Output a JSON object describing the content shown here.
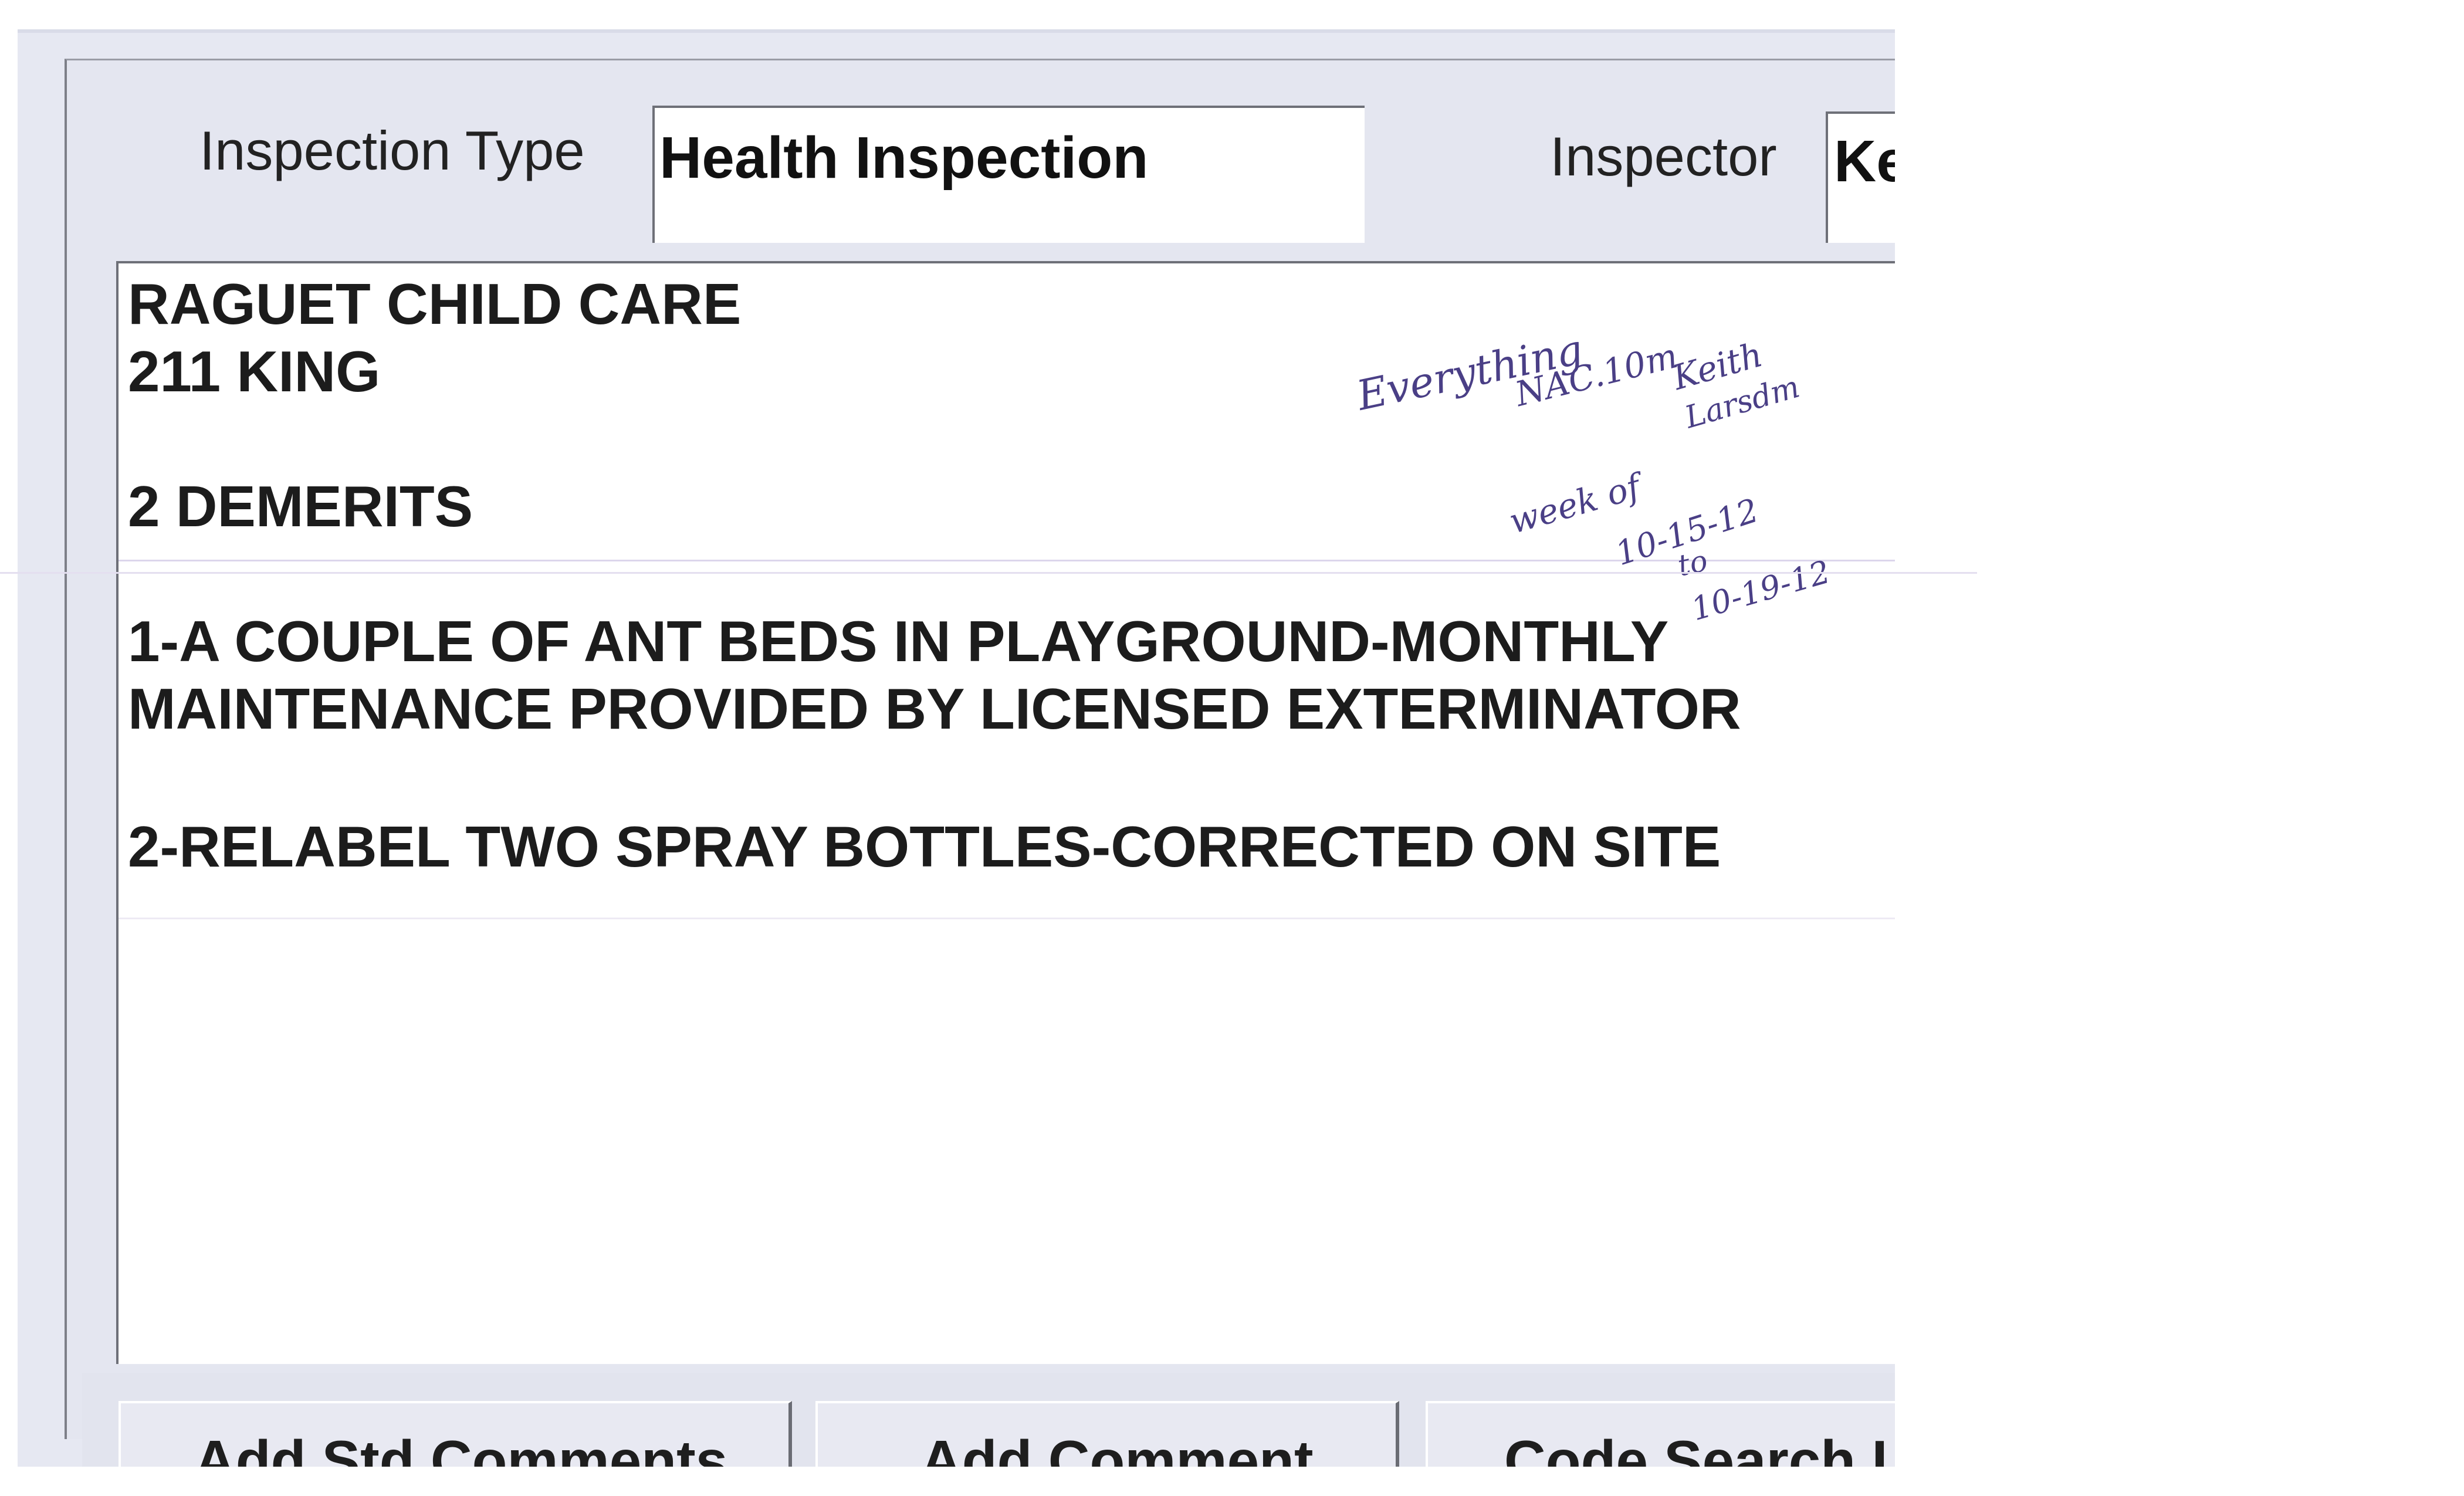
{
  "form": {
    "inspection_type_label": "Inspection Type",
    "inspection_type_value": "Health Inspection",
    "inspector_label": "Inspector",
    "inspector_value": "Ke"
  },
  "comments": {
    "lines": [
      "RAGUET CHILD CARE",
      "211 KING",
      "2 DEMERITS",
      "1-A COUPLE OF ANT BEDS IN PLAYGROUND-MONTHLY",
      "MAINTENANCE PROVIDED BY LICENSED EXTERMINATOR",
      "2-RELABEL TWO SPRAY BOTTLES-CORRECTED ON SITE"
    ]
  },
  "buttons": {
    "add_std_comments": {
      "pre": "Add ",
      "mnemonic": "S",
      "post": "td Comments"
    },
    "add_comment": {
      "pre": "",
      "mnemonic": "A",
      "post": "dd Comment"
    },
    "code_search": {
      "label": "Code Search Li"
    }
  },
  "handwritten_note": {
    "lines": [
      "Everything",
      "NAC.10m",
      "Keith",
      "Larsdm",
      "week of",
      "10-15-12",
      "to",
      "10-19-12"
    ]
  },
  "colors": {
    "window_background": "#e6e8f2",
    "field_background": "#ffffff",
    "handwriting_ink": "#4a3f86"
  }
}
